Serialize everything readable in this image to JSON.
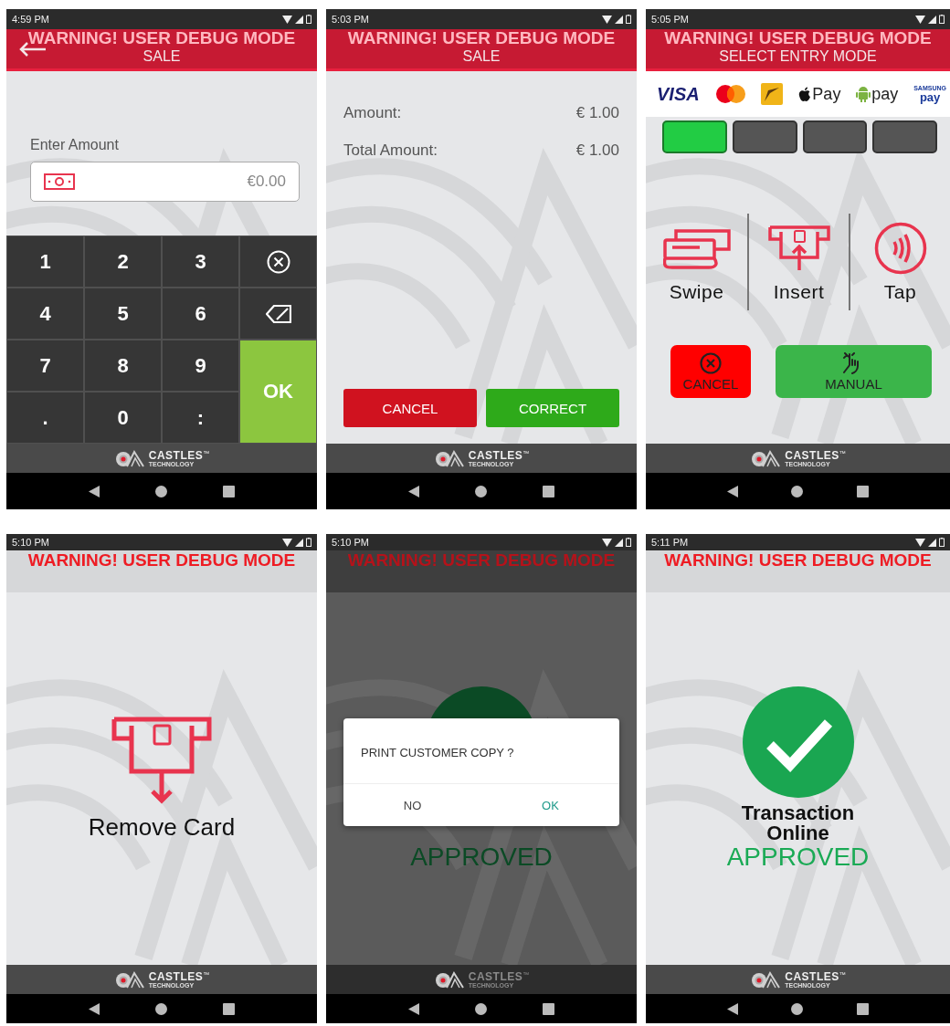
{
  "screens": [
    {
      "kind": "amount_entry",
      "status_bar": {
        "time": "4:59 PM"
      },
      "header": {
        "kind": "title",
        "warning": "WARNING! USER DEBUG MODE",
        "title": "SALE",
        "back": true
      },
      "label": "Enter Amount",
      "amount_field": {
        "value": "€0.00"
      },
      "keys": [
        {
          "kind": "digit",
          "label": "1"
        },
        {
          "kind": "digit",
          "label": "2"
        },
        {
          "kind": "digit",
          "label": "3"
        },
        {
          "kind": "clear"
        },
        {
          "kind": "digit",
          "label": "4"
        },
        {
          "kind": "digit",
          "label": "5"
        },
        {
          "kind": "digit",
          "label": "6"
        },
        {
          "kind": "backspace"
        },
        {
          "kind": "digit",
          "label": "7"
        },
        {
          "kind": "digit",
          "label": "8"
        },
        {
          "kind": "digit",
          "label": "9"
        },
        {
          "kind": "ok",
          "label": "OK"
        },
        {
          "kind": "digit",
          "label": "."
        },
        {
          "kind": "digit",
          "label": "0"
        },
        {
          "kind": "digit",
          "label": ":"
        }
      ],
      "footer": {
        "brand": "CASTLES",
        "trademark": "™",
        "tagline": "TECHNOLOGY"
      }
    },
    {
      "kind": "confirm_amount",
      "status_bar": {
        "time": "5:03 PM"
      },
      "header": {
        "kind": "title",
        "warning": "WARNING! USER DEBUG MODE",
        "title": "SALE",
        "back": false
      },
      "rows": [
        {
          "label": "Amount:",
          "value": "€ 1.00"
        },
        {
          "label": "Total Amount:",
          "value": "€ 1.00"
        }
      ],
      "buttons": [
        {
          "kind": "cancel",
          "label": "CANCEL"
        },
        {
          "kind": "confirm",
          "label": "CORRECT"
        }
      ],
      "footer": {
        "brand": "CASTLES",
        "trademark": "™",
        "tagline": "TECHNOLOGY"
      }
    },
    {
      "kind": "entry_mode",
      "status_bar": {
        "time": "5:05 PM"
      },
      "header": {
        "kind": "title",
        "warning": "WARNING! USER DEBUG MODE",
        "title": "SELECT ENTRY MODE",
        "back": false
      },
      "payment_logos": [
        {
          "kind": "visa",
          "text": "VISA"
        },
        {
          "kind": "mastercard"
        },
        {
          "kind": "card"
        },
        {
          "kind": "apple",
          "text": "Pay"
        },
        {
          "kind": "android",
          "text": "pay"
        },
        {
          "kind": "samsung",
          "text": "SAMSUNG",
          "subtext": "pay"
        }
      ],
      "leds": [
        {
          "on": true
        },
        {
          "on": false
        },
        {
          "on": false
        },
        {
          "on": false
        }
      ],
      "options": [
        {
          "kind": "swipe",
          "label": "Swipe"
        },
        {
          "kind": "insert",
          "label": "Insert"
        },
        {
          "kind": "tap",
          "label": "Tap"
        }
      ],
      "buttons": [
        {
          "kind": "cancel",
          "label": "CANCEL"
        },
        {
          "kind": "manual",
          "label": "MANUAL"
        }
      ],
      "footer": {
        "brand": "CASTLES",
        "trademark": "™",
        "tagline": "TECHNOLOGY"
      }
    },
    {
      "kind": "remove_card",
      "status_bar": {
        "time": "5:10 PM"
      },
      "header": {
        "kind": "banner",
        "warning": "WARNING! USER DEBUG MODE",
        "back": false
      },
      "message": "Remove Card",
      "footer": {
        "brand": "CASTLES",
        "trademark": "™",
        "tagline": "TECHNOLOGY"
      }
    },
    {
      "kind": "result",
      "dimmed": true,
      "status_bar": {
        "time": "5:10 PM"
      },
      "header": {
        "kind": "banner",
        "warning": "WARNING! USER DEBUG MODE",
        "back": false
      },
      "status": "APPROVED",
      "dialog": {
        "message": "PRINT CUSTOMER COPY ?",
        "buttons": [
          {
            "kind": "negative",
            "label": "NO"
          },
          {
            "kind": "positive",
            "label": "OK"
          }
        ]
      },
      "footer": {
        "brand": "CASTLES",
        "trademark": "™",
        "tagline": "TECHNOLOGY"
      }
    },
    {
      "kind": "result",
      "dimmed": false,
      "status_bar": {
        "time": "5:11 PM"
      },
      "header": {
        "kind": "banner",
        "warning": "WARNING! USER DEBUG MODE",
        "back": false
      },
      "lines": [
        "Transaction",
        "Online"
      ],
      "status": "APPROVED",
      "footer": {
        "brand": "CASTLES",
        "trademark": "™",
        "tagline": "TECHNOLOGY"
      }
    }
  ]
}
